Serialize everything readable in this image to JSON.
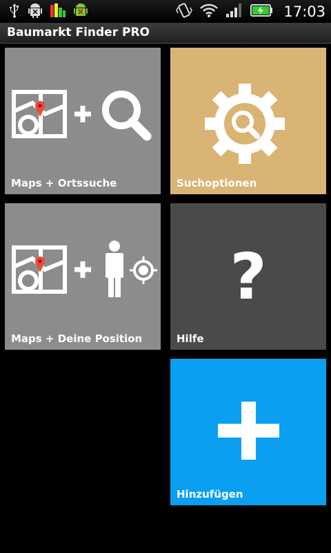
{
  "status_bar": {
    "time": "17:03",
    "icons": [
      "usb-icon",
      "android-debug-icon",
      "signal-meter-icon",
      "android-update-icon",
      "vibrate-icon",
      "wifi-icon",
      "cell-signal-icon",
      "battery-charging-icon"
    ]
  },
  "app": {
    "title": "Baumarkt Finder PRO"
  },
  "tiles": [
    {
      "label": "Maps + Ortssuche",
      "color": "#8c8c8c",
      "icon": "map-plus-search-icon"
    },
    {
      "label": "Suchoptionen",
      "color": "#d9b474",
      "icon": "gear-search-icon"
    },
    {
      "label": "Maps + Deine Position",
      "color": "#8c8c8c",
      "icon": "map-plus-person-icon"
    },
    {
      "label": "Hilfe",
      "color": "#4a4a4a",
      "icon": "question-mark-icon"
    },
    {
      "label": "Hinzufügen",
      "color": "#0a9ff0",
      "icon": "plus-icon"
    }
  ]
}
